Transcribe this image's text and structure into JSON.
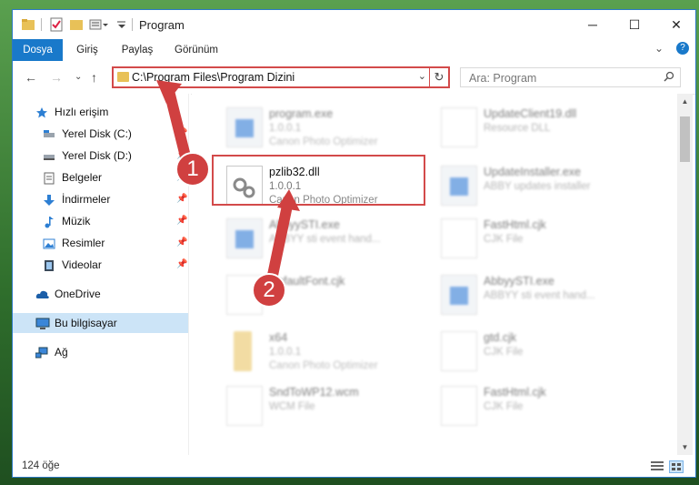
{
  "window": {
    "title": "Program",
    "controls": {
      "minimize": "─",
      "maximize": "☐",
      "close": "✕"
    }
  },
  "ribbon": {
    "tabs": [
      "Dosya",
      "Giriş",
      "Paylaş",
      "Görünüm"
    ],
    "collapse": "⌄",
    "help": "?"
  },
  "navigation": {
    "back": "←",
    "forward": "→",
    "recent": "⌄",
    "up": "↑"
  },
  "address": {
    "path": "C:\\Program Files\\Program Dizini",
    "dropdown": "⌄",
    "refresh": "↻"
  },
  "search": {
    "placeholder": "Ara: Program",
    "icon": "search-icon"
  },
  "sidebar": {
    "items": [
      {
        "label": "Hızlı erişim",
        "icon": "star-icon",
        "pinned": false
      },
      {
        "label": "Yerel Disk (C:)",
        "icon": "drive-icon",
        "pinned": true
      },
      {
        "label": "Yerel Disk (D:)",
        "icon": "drive-icon",
        "pinned": true
      },
      {
        "label": "Belgeler",
        "icon": "documents-icon",
        "pinned": true
      },
      {
        "label": "İndirmeler",
        "icon": "download-icon",
        "pinned": true
      },
      {
        "label": "Müzik",
        "icon": "music-icon",
        "pinned": true
      },
      {
        "label": "Resimler",
        "icon": "pictures-icon",
        "pinned": true
      },
      {
        "label": "Videolar",
        "icon": "video-icon",
        "pinned": true
      },
      {
        "label": "OneDrive",
        "icon": "cloud-icon",
        "pinned": false
      },
      {
        "label": "Bu bilgisayar",
        "icon": "computer-icon",
        "pinned": false,
        "selected": true
      },
      {
        "label": "Ağ",
        "icon": "network-icon",
        "pinned": false
      }
    ],
    "pin_glyph": "📌"
  },
  "files": [
    {
      "name": "program.exe",
      "version": "1.0.0.1",
      "description": "Canon Photo Optimizer",
      "icon": "exe"
    },
    {
      "name": "UpdateClient19.dll",
      "version": "",
      "description": "Resource DLL",
      "icon": "dll"
    },
    {
      "name": "pzlib32.dll",
      "version": "1.0.0.1",
      "description": "Canon Photo Optimizer",
      "icon": "dll",
      "highlighted": true
    },
    {
      "name": "UpdateInstaller.exe",
      "version": "",
      "description": "ABBY updates installer",
      "icon": "exe"
    },
    {
      "name": "AbbyySTI.exe",
      "version": "",
      "description": "ABBYY sti event hand...",
      "icon": "exe"
    },
    {
      "name": "FastHtml.cjk",
      "version": "",
      "description": "CJK File",
      "icon": "doc"
    },
    {
      "name": "DefaultFont.cjk",
      "version": "",
      "description": "",
      "icon": "doc"
    },
    {
      "name": "AbbyySTI.exe",
      "version": "",
      "description": "ABBYY sti event hand...",
      "icon": "exe"
    },
    {
      "name": "x64",
      "version": "1.0.0.1",
      "description": "Canon Photo Optimizer",
      "icon": "folder"
    },
    {
      "name": "gtd.cjk",
      "version": "",
      "description": "CJK File",
      "icon": "doc"
    },
    {
      "name": "SndToWP12.wcm",
      "version": "",
      "description": "WCM File",
      "icon": "doc"
    },
    {
      "name": "FastHtml.cjk",
      "version": "",
      "description": "CJK File",
      "icon": "doc"
    }
  ],
  "status": {
    "item_count": "124 öğe"
  },
  "annotations": {
    "badge1": "1",
    "badge2": "2",
    "color": "#d04040"
  }
}
